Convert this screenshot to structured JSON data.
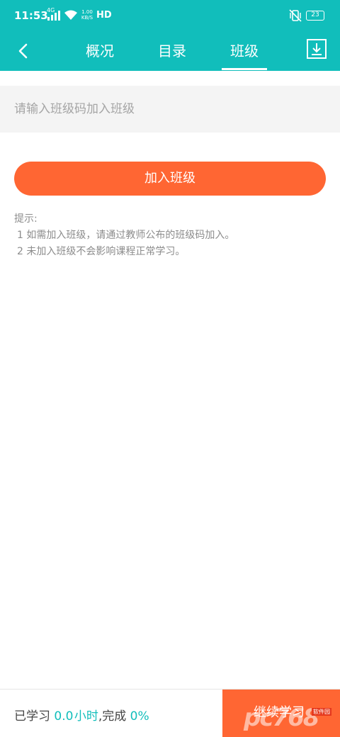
{
  "status_bar": {
    "time": "11:53",
    "network": "4G",
    "speed_value": "1.00",
    "speed_unit": "KB/S",
    "hd": "HD",
    "battery": "23"
  },
  "nav": {
    "tabs": [
      {
        "label": "概况",
        "active": false
      },
      {
        "label": "目录",
        "active": false
      },
      {
        "label": "班级",
        "active": true
      }
    ]
  },
  "join_form": {
    "placeholder": "请输入班级码加入班级",
    "value": "",
    "button_label": "加入班级"
  },
  "tips": {
    "title": "提示:",
    "lines": [
      "1 如需加入班级，请通过教师公布的班级码加入。",
      "2 未加入班级不会影响课程正常学习。"
    ]
  },
  "bottom_bar": {
    "studied_label": "已学习",
    "hours": "0.0",
    "hours_unit": "小时",
    "separator": ",完成",
    "percent": "0%",
    "continue_label": "继续学习"
  },
  "watermark": {
    "text": "pc768",
    "tag": "软件园"
  },
  "colors": {
    "primary": "#11bebb",
    "accent_orange": "#ff6633"
  },
  "icons": [
    "back-arrow-icon",
    "download-icon",
    "signal-icon",
    "wifi-icon",
    "vibrate-icon",
    "battery-icon"
  ]
}
